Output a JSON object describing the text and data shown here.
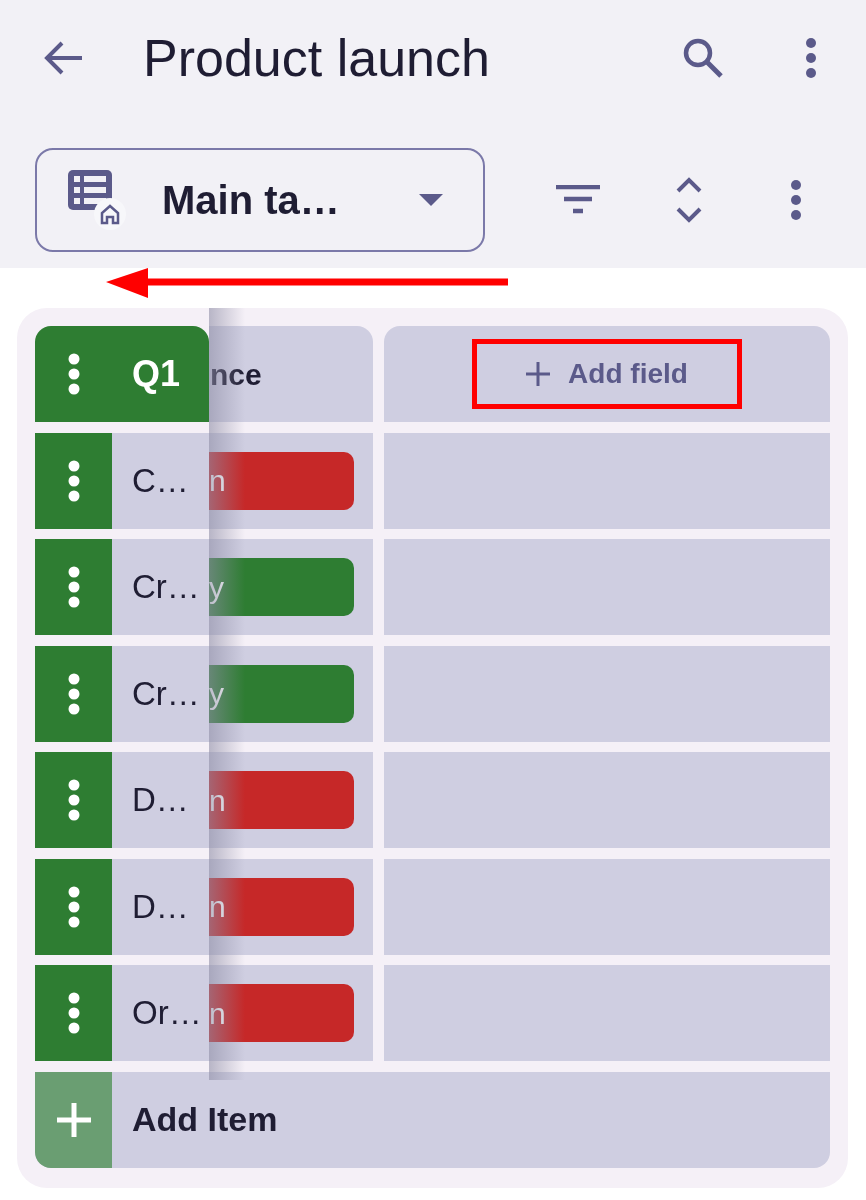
{
  "app_bar": {
    "title": "Product launch"
  },
  "view_selector": {
    "label": "Main ta…"
  },
  "table": {
    "columns": [
      {
        "kind": "pinned",
        "header": "Q1"
      },
      {
        "kind": "tag",
        "header": "nce"
      },
      {
        "kind": "add",
        "header": "Add field"
      }
    ],
    "rows": [
      {
        "name": "C…",
        "tag": {
          "text": "n",
          "color": "#c62828"
        }
      },
      {
        "name": "Cr…",
        "tag": {
          "text": "y",
          "color": "#2e7d32"
        }
      },
      {
        "name": "Cr…",
        "tag": {
          "text": "y",
          "color": "#2e7d32"
        }
      },
      {
        "name": "D…",
        "tag": {
          "text": "n",
          "color": "#c62828"
        }
      },
      {
        "name": "D…",
        "tag": {
          "text": "n",
          "color": "#c62828"
        }
      },
      {
        "name": "Or…",
        "tag": {
          "text": "n",
          "color": "#c62828"
        }
      }
    ],
    "add_item": {
      "label": "Add Item"
    }
  },
  "tutorial": {
    "swipe_arrow": true,
    "highlight_add_field": true
  }
}
